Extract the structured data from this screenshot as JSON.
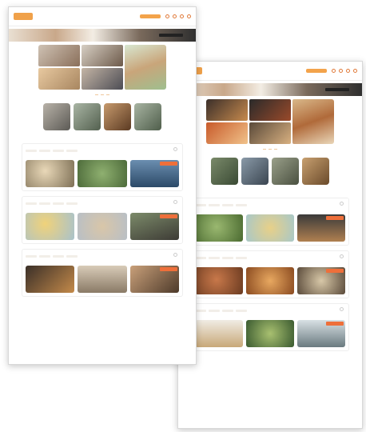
{
  "left": {
    "nav": {
      "logo": "",
      "text": "",
      "tab": "",
      "search_placeholder": ""
    },
    "banner": {
      "text": "",
      "cta": ""
    },
    "caption": "",
    "pills": [
      "",
      "",
      ""
    ],
    "section_title": "",
    "count": {
      "value": "",
      "label": ""
    },
    "cards": [
      {
        "title": "",
        "meta": "",
        "button": ""
      },
      {
        "title": "",
        "meta": "",
        "button": ""
      },
      {
        "title": "",
        "meta": "",
        "button": ""
      }
    ]
  },
  "right": {
    "nav": {
      "logo": "",
      "text": "",
      "tab": ""
    },
    "banner": {
      "text": "",
      "cta": ""
    },
    "caption": "",
    "pills": [
      "",
      "",
      ""
    ],
    "section_title": "",
    "count": {
      "value": "",
      "label": ""
    },
    "cards": [
      {
        "title": "",
        "meta": "",
        "button": ""
      },
      {
        "title": "",
        "meta": "",
        "button": ""
      },
      {
        "title": "",
        "meta": "",
        "button": ""
      }
    ]
  },
  "colors": {
    "accent": "#f0a14a",
    "button": "#ee6f3a",
    "link": "#d27a2c"
  }
}
